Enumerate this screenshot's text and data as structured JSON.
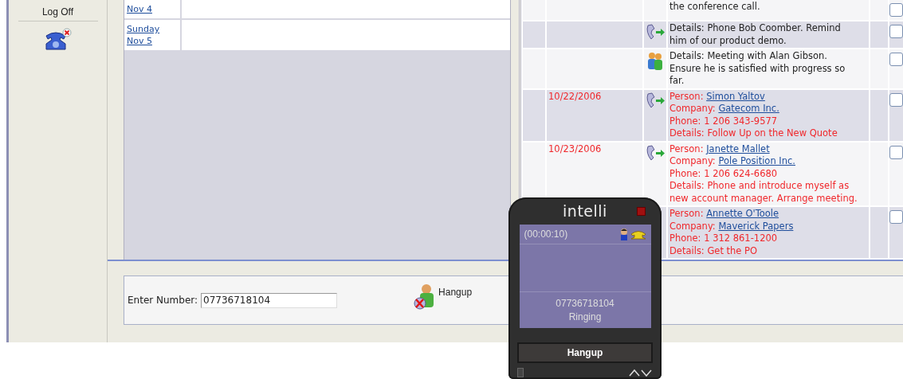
{
  "sidebar": {
    "logoff": "Log Off"
  },
  "calendar": {
    "days": [
      {
        "lines": [
          "Nov 4"
        ]
      },
      {
        "lines": [
          "Sunday",
          "Nov 5"
        ]
      }
    ]
  },
  "tasks": [
    {
      "overdue": false,
      "kind": "none",
      "checked": false,
      "lines": [
        {
          "text": "the conference call."
        }
      ]
    },
    {
      "overdue": false,
      "kind": "call",
      "checked": false,
      "lines": [
        {
          "text": "Details: Phone Bob Coomber. Remind him of our product demo."
        }
      ]
    },
    {
      "overdue": false,
      "kind": "meeting",
      "checked": false,
      "lines": [
        {
          "text": "Details: Meeting with Alan Gibson. Ensure he is satisfied with progress so far."
        }
      ]
    },
    {
      "overdue": true,
      "date": "10/22/2006",
      "kind": "call",
      "checked": false,
      "lines": [
        {
          "text": "Person:",
          "link": "Simon Yaltov"
        },
        {
          "text": "Company:",
          "link": "Gatecom Inc."
        },
        {
          "text": "Phone: 1 206 343-9577"
        },
        {
          "text": "Details: Follow Up on the New Quote"
        }
      ]
    },
    {
      "overdue": true,
      "date": "10/23/2006",
      "kind": "call",
      "checked": false,
      "lines": [
        {
          "text": "Person:",
          "link": "Janette Mallet"
        },
        {
          "text": "Company:",
          "link": "Pole Position Inc."
        },
        {
          "text": "Phone: 1 206 624-6680"
        },
        {
          "text": "Details: Phone and introduce myself as new account manager. Arrange meeting."
        }
      ]
    },
    {
      "overdue": true,
      "kind": "none",
      "checked": false,
      "lines": [
        {
          "text": "Person:",
          "link": "Annette O'Toole"
        },
        {
          "text": "Company:",
          "link": "Maverick Papers"
        },
        {
          "text": "Phone: 1 312 861-1200"
        },
        {
          "text": "Details: Get the PO"
        }
      ]
    }
  ],
  "dialer": {
    "label": "Enter Number:",
    "value": "07736718104",
    "hangup": "Hangup"
  },
  "phone_popup": {
    "brand": "intelli",
    "timer": "(00:00:10)",
    "number": "07736718104",
    "status": "Ringing",
    "hangup": "Hangup"
  }
}
